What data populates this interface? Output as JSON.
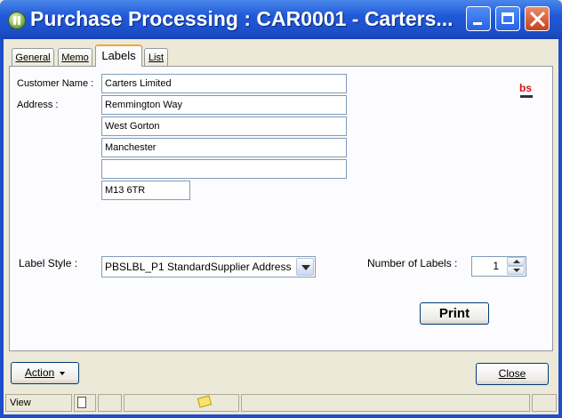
{
  "window": {
    "title": "Purchase Processing : CAR0001 - Carters...",
    "buttons": [
      "minimize-icon",
      "maximize-icon",
      "close-icon"
    ]
  },
  "tabs": [
    {
      "label": "General",
      "active": false
    },
    {
      "label": "Memo",
      "active": false
    },
    {
      "label": "Labels",
      "active": true
    },
    {
      "label": "List",
      "active": false
    }
  ],
  "form": {
    "customer_name_label": "Customer Name :",
    "customer_name": "Carters Limited",
    "address_label": "Address :",
    "address_lines": [
      "Remmington Way",
      "West Gorton",
      "Manchester",
      ""
    ],
    "postcode": "M13 6TR",
    "logo_text": "bs",
    "label_style_label": "Label Style :",
    "label_style_value": "PBSLBL_P1 StandardSupplier Address",
    "num_labels_label": "Number of Labels :",
    "num_labels_value": "1",
    "print_label": "Print"
  },
  "footer": {
    "action_label": "Action",
    "close_label": "Close"
  },
  "statusbar": {
    "mode": "View",
    "icons": [
      "document-icon",
      "note-icon"
    ]
  },
  "colors": {
    "titlebar": "#2159d9",
    "tab_active_accent": "#f5a72d",
    "logo_red": "#d0151a",
    "field_border": "#7f9db9"
  }
}
